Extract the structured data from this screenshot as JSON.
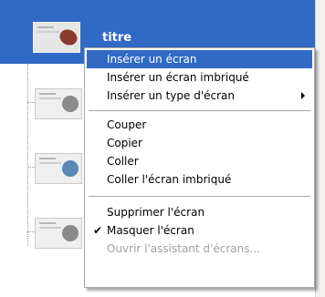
{
  "tree": {
    "selected_item_title": "titre",
    "thumbnail_icons": [
      "car-thumbnail-icon",
      "camera-thumbnail-icon",
      "globe-thumbnail-icon",
      "clock-thumbnail-icon"
    ]
  },
  "colors": {
    "selection_blue": "#316ac5",
    "menu_border": "#a7a6aa",
    "disabled_text": "#a0a0a0"
  },
  "context_menu": {
    "items": [
      {
        "label": "Insérer un écran",
        "highlighted": true
      },
      {
        "label": "Insérer un écran imbriqué"
      },
      {
        "label": "Insérer un type d'écran",
        "submenu": true
      },
      {
        "label": "Couper"
      },
      {
        "label": "Copier"
      },
      {
        "label": "Coller"
      },
      {
        "label": "Coller l'écran imbriqué"
      },
      {
        "label": "Supprimer l'écran"
      },
      {
        "label": "Masquer l'écran",
        "checked": true,
        "check_mark": "✔"
      },
      {
        "label": "Ouvrir l'assistant d'écrans...",
        "disabled": true
      }
    ]
  }
}
